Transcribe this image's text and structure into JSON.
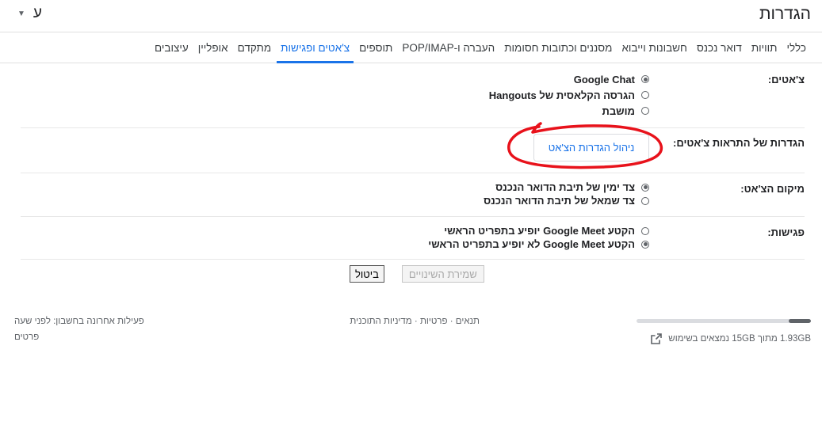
{
  "header": {
    "title": "הגדרות",
    "language_label": "ע",
    "language_arrow": "▼"
  },
  "tabs": [
    {
      "label": "כללי",
      "active": false
    },
    {
      "label": "תוויות",
      "active": false
    },
    {
      "label": "דואר נכנס",
      "active": false
    },
    {
      "label": "חשבונות וייבוא",
      "active": false
    },
    {
      "label": "מסננים וכתובות חסומות",
      "active": false
    },
    {
      "label": "העברה ו-POP/IMAP",
      "active": false
    },
    {
      "label": "תוספים",
      "active": false
    },
    {
      "label": "צ'אטים ופגישות",
      "active": true
    },
    {
      "label": "מתקדם",
      "active": false
    },
    {
      "label": "אופליין",
      "active": false
    },
    {
      "label": "עיצובים",
      "active": false
    }
  ],
  "chat": {
    "label": "צ'אטים:",
    "options": [
      {
        "label": "Google Chat",
        "checked": true
      },
      {
        "label": "הגרסה הקלאסית של Hangouts",
        "checked": false
      },
      {
        "label": "מושבת",
        "checked": false
      }
    ]
  },
  "notifications": {
    "label": "הגדרות של התראות צ'אטים:",
    "button_label": "ניהול הגדרות הצ'אט",
    "annotation_color": "#e8121b"
  },
  "position": {
    "label": "מיקום הצ'אט:",
    "options": [
      {
        "label": "צד ימין של תיבת הדואר הנכנס",
        "checked": true
      },
      {
        "label": "צד שמאל של תיבת הדואר הנכנס",
        "checked": false
      }
    ]
  },
  "meet": {
    "label": "פגישות:",
    "options": [
      {
        "label": "הקטע Google Meet יופיע בתפריט הראשי",
        "checked": false
      },
      {
        "label": "הקטע Google Meet לא יופיע בתפריט הראשי",
        "checked": true
      }
    ]
  },
  "actions": {
    "save_label": "שמירת השינויים",
    "cancel_label": "ביטול"
  },
  "footer": {
    "storage_text": "1.93GB מתוך 15GB נמצאים בשימוש",
    "storage_used_fraction": 0.129,
    "links": {
      "terms": "תנאים",
      "privacy": "פרטיות",
      "program_policies": "מדיניות התוכנית",
      "separator": "·"
    },
    "activity_text": "פעילות אחרונה בחשבון: לפני שעה",
    "details_link": "פרטים"
  },
  "colors": {
    "accent": "#1a73e8",
    "text": "#202124",
    "muted": "#5f6368"
  }
}
